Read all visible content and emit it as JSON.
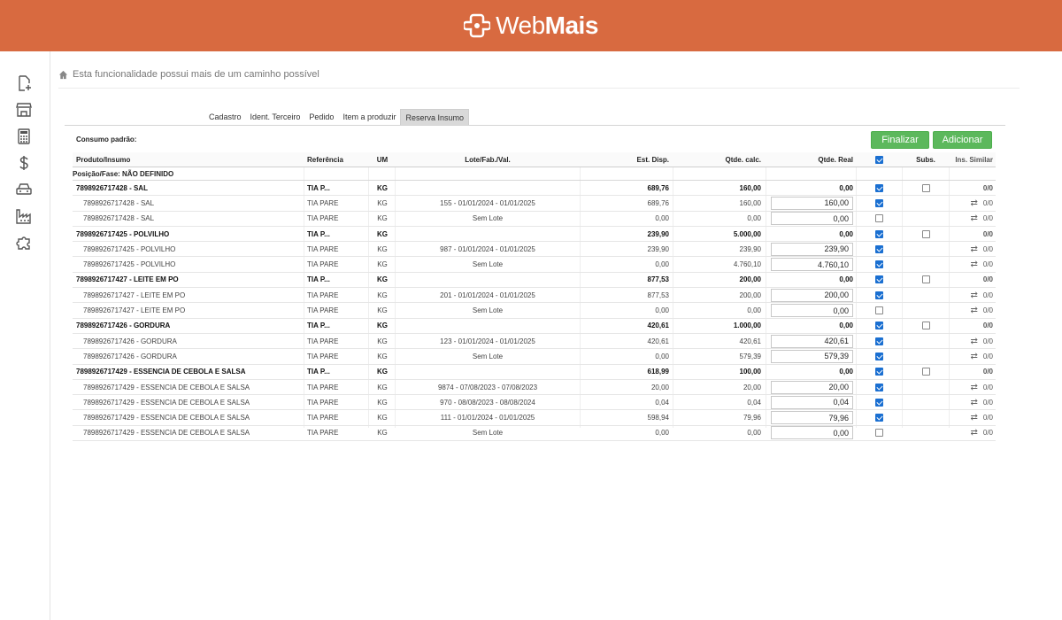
{
  "brand": {
    "name_light": "Web",
    "name_bold": "Mais"
  },
  "breadcrumb": {
    "text": "Esta funcionalidade possui mais de um caminho possível"
  },
  "tabs": [
    {
      "label": "Cadastro",
      "active": false
    },
    {
      "label": "Ident. Terceiro",
      "active": false
    },
    {
      "label": "Pedido",
      "active": false
    },
    {
      "label": "Item a produzir",
      "active": false
    },
    {
      "label": "Reserva Insumo",
      "active": true
    }
  ],
  "consumo_label": "Consumo padrão:",
  "buttons": {
    "finalizar": "Finalizar",
    "adicionar": "Adicionar"
  },
  "table": {
    "headers": {
      "produto": "Produto/Insumo",
      "referencia": "Referência",
      "um": "UM",
      "lote": "Lote/Fab./Val.",
      "est": "Est. Disp.",
      "calc": "Qtde. calc.",
      "real": "Qtde. Real",
      "subs": "Subs.",
      "ins": "Ins. Similar"
    },
    "posicao": "Posição/Fase: NÃO DEFINIDO",
    "rows": [
      {
        "type": "parent",
        "produto": "7898926717428 - SAL",
        "ref": "TIA P...",
        "um": "KG",
        "lote": "",
        "est": "689,76",
        "calc": "160,00",
        "real": "0,00",
        "chk": true,
        "subs": "0/0"
      },
      {
        "type": "child",
        "produto": "7898926717428 - SAL",
        "ref": "TIA PARE",
        "um": "KG",
        "lote": "155 - 01/01/2024 - 01/01/2025",
        "est": "689,76",
        "calc": "160,00",
        "real": "160,00",
        "chk": true,
        "subs": "0/0"
      },
      {
        "type": "child",
        "produto": "7898926717428 - SAL",
        "ref": "TIA PARE",
        "um": "KG",
        "lote": "Sem Lote",
        "est": "0,00",
        "calc": "0,00",
        "real": "0,00",
        "chk": false,
        "subs": "0/0"
      },
      {
        "type": "parent",
        "produto": "7898926717425 - POLVILHO",
        "ref": "TIA P...",
        "um": "KG",
        "lote": "",
        "est": "239,90",
        "calc": "5.000,00",
        "real": "0,00",
        "chk": true,
        "subs": "0/0"
      },
      {
        "type": "child",
        "produto": "7898926717425 - POLVILHO",
        "ref": "TIA PARE",
        "um": "KG",
        "lote": "987 - 01/01/2024 - 01/01/2025",
        "est": "239,90",
        "calc": "239,90",
        "real": "239,90",
        "chk": true,
        "subs": "0/0"
      },
      {
        "type": "child",
        "produto": "7898926717425 - POLVILHO",
        "ref": "TIA PARE",
        "um": "KG",
        "lote": "Sem Lote",
        "est": "0,00",
        "calc": "4.760,10",
        "real": "4.760,10",
        "chk": true,
        "subs": "0/0"
      },
      {
        "type": "parent",
        "produto": "7898926717427 - LEITE EM PO",
        "ref": "TIA P...",
        "um": "KG",
        "lote": "",
        "est": "877,53",
        "calc": "200,00",
        "real": "0,00",
        "chk": true,
        "subs": "0/0"
      },
      {
        "type": "child",
        "produto": "7898926717427 - LEITE EM PO",
        "ref": "TIA PARE",
        "um": "KG",
        "lote": "201 - 01/01/2024 - 01/01/2025",
        "est": "877,53",
        "calc": "200,00",
        "real": "200,00",
        "chk": true,
        "subs": "0/0"
      },
      {
        "type": "child",
        "produto": "7898926717427 - LEITE EM PO",
        "ref": "TIA PARE",
        "um": "KG",
        "lote": "Sem Lote",
        "est": "0,00",
        "calc": "0,00",
        "real": "0,00",
        "chk": false,
        "subs": "0/0"
      },
      {
        "type": "parent",
        "produto": "7898926717426 - GORDURA",
        "ref": "TIA P...",
        "um": "KG",
        "lote": "",
        "est": "420,61",
        "calc": "1.000,00",
        "real": "0,00",
        "chk": true,
        "subs": "0/0"
      },
      {
        "type": "child",
        "produto": "7898926717426 - GORDURA",
        "ref": "TIA PARE",
        "um": "KG",
        "lote": "123 - 01/01/2024 - 01/01/2025",
        "est": "420,61",
        "calc": "420,61",
        "real": "420,61",
        "chk": true,
        "subs": "0/0"
      },
      {
        "type": "child",
        "produto": "7898926717426 - GORDURA",
        "ref": "TIA PARE",
        "um": "KG",
        "lote": "Sem Lote",
        "est": "0,00",
        "calc": "579,39",
        "real": "579,39",
        "chk": true,
        "subs": "0/0"
      },
      {
        "type": "parent",
        "produto": "7898926717429 - ESSENCIA DE CEBOLA E SALSA",
        "ref": "TIA P...",
        "um": "KG",
        "lote": "",
        "est": "618,99",
        "calc": "100,00",
        "real": "0,00",
        "chk": true,
        "subs": "0/0"
      },
      {
        "type": "child",
        "produto": "7898926717429 - ESSENCIA DE CEBOLA E SALSA",
        "ref": "TIA PARE",
        "um": "KG",
        "lote": "9874 - 07/08/2023 - 07/08/2023",
        "est": "20,00",
        "calc": "20,00",
        "real": "20,00",
        "chk": true,
        "subs": "0/0"
      },
      {
        "type": "child",
        "produto": "7898926717429 - ESSENCIA DE CEBOLA E SALSA",
        "ref": "TIA PARE",
        "um": "KG",
        "lote": "970 - 08/08/2023 - 08/08/2024",
        "est": "0,04",
        "calc": "0,04",
        "real": "0,04",
        "chk": true,
        "subs": "0/0"
      },
      {
        "type": "child",
        "produto": "7898926717429 - ESSENCIA DE CEBOLA E SALSA",
        "ref": "TIA PARE",
        "um": "KG",
        "lote": "111 - 01/01/2024 - 01/01/2025",
        "est": "598,94",
        "calc": "79,96",
        "real": "79,96",
        "chk": true,
        "subs": "0/0"
      },
      {
        "type": "child",
        "produto": "7898926717429 - ESSENCIA DE CEBOLA E SALSA",
        "ref": "TIA PARE",
        "um": "KG",
        "lote": "Sem Lote",
        "est": "0,00",
        "calc": "0,00",
        "real": "0,00",
        "chk": false,
        "subs": "0/0"
      }
    ]
  },
  "sidebar_icons": [
    "new-document-icon",
    "store-icon",
    "calculator-icon",
    "dollar-icon",
    "car-icon",
    "factory-icon",
    "puzzle-icon"
  ],
  "colors": {
    "topbar": "#d86a40",
    "button_green": "#5cb85c",
    "checkbox_blue": "#1a6fd1"
  }
}
